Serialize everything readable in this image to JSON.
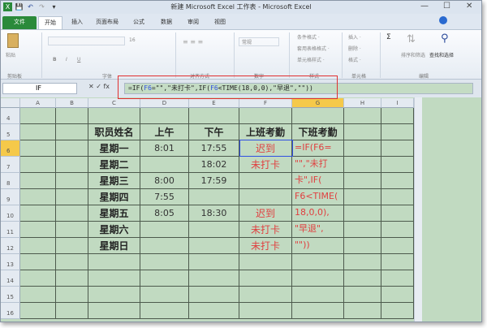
{
  "window": {
    "title": "新建 Microsoft Excel 工作表 - Microsoft Excel",
    "controls": [
      "—",
      "☐",
      "✕"
    ]
  },
  "quick_access": [
    "X",
    "💾",
    "↶",
    "↷",
    "▾"
  ],
  "tabs": [
    "文件",
    "开始",
    "插入",
    "页面布局",
    "公式",
    "数据",
    "审阅",
    "视图"
  ],
  "ribbon": {
    "groups": [
      "剪贴板",
      "字体",
      "对齐方式",
      "数字",
      "样式",
      "单元格",
      "编辑"
    ],
    "paste": "粘贴",
    "font_size": "16",
    "number_format": "常规",
    "styles": [
      "条件格式 ·",
      "套用表格格式 ·",
      "单元格样式 ·"
    ],
    "cells": [
      "插入 ·",
      "删除 ·",
      "格式 ·"
    ],
    "sort": "排序和筛选",
    "find": "查找和选择"
  },
  "formula_bar": {
    "name_box": "IF",
    "fx": "✕ ✓ fx",
    "segments": [
      {
        "t": "=IF(",
        "c": "#222"
      },
      {
        "t": "F6",
        "c": "#3050e0"
      },
      {
        "t": "=\"\",\"未打卡\",IF(",
        "c": "#222"
      },
      {
        "t": "F6",
        "c": "#3050e0"
      },
      {
        "t": "<TIME(18,0,0),\"早退\",\"\"))",
        "c": "#222"
      }
    ]
  },
  "columns": [
    "A",
    "B",
    "C",
    "D",
    "E",
    "F",
    "G",
    "H",
    "I"
  ],
  "selected_column": "G",
  "selected_row": 6,
  "rows": [
    {
      "n": "4",
      "cells": [
        "",
        "",
        "",
        "",
        "",
        "",
        ""
      ]
    },
    {
      "n": "5",
      "cells": [
        "",
        "",
        "职员姓名",
        "上午",
        "下午",
        "上班考勤",
        "下班考勤"
      ]
    },
    {
      "n": "6",
      "cells": [
        "",
        "",
        "星期一",
        "8:01",
        "17:55",
        "迟到",
        ""
      ]
    },
    {
      "n": "7",
      "cells": [
        "",
        "",
        "星期二",
        "",
        "18:02",
        "未打卡",
        ""
      ]
    },
    {
      "n": "8",
      "cells": [
        "",
        "",
        "星期三",
        "8:00",
        "17:59",
        "",
        ""
      ]
    },
    {
      "n": "9",
      "cells": [
        "",
        "",
        "星期四",
        "7:55",
        "",
        "",
        ""
      ]
    },
    {
      "n": "10",
      "cells": [
        "",
        "",
        "星期五",
        "8:05",
        "18:30",
        "迟到",
        ""
      ]
    },
    {
      "n": "11",
      "cells": [
        "",
        "",
        "星期六",
        "",
        "",
        "未打卡",
        ""
      ]
    },
    {
      "n": "12",
      "cells": [
        "",
        "",
        "星期日",
        "",
        "",
        "未打卡",
        ""
      ]
    },
    {
      "n": "13",
      "cells": [
        "",
        "",
        "",
        "",
        "",
        "",
        ""
      ]
    },
    {
      "n": "14",
      "cells": [
        "",
        "",
        "",
        "",
        "",
        "",
        ""
      ]
    },
    {
      "n": "15",
      "cells": [
        "",
        "",
        "",
        "",
        "",
        "",
        ""
      ]
    },
    {
      "n": "16",
      "cells": [
        "",
        "",
        "",
        "",
        "",
        "",
        ""
      ]
    }
  ],
  "g6_wrapped": [
    "=IF(F6=",
    "\"\",\"未打",
    "卡\",IF(",
    "F6<TIME(",
    "18,0,0),",
    "\"早退\",",
    "\"\"))"
  ],
  "colors": {
    "accent": "#2a8a3a",
    "highlight_box": "#e03030",
    "cell_bg": "#c1dac1",
    "red_text": "#e04040"
  }
}
